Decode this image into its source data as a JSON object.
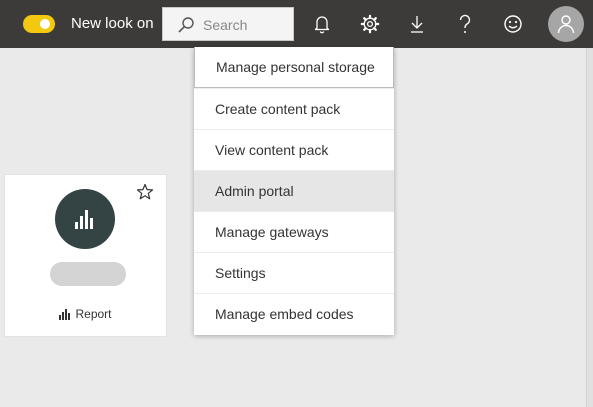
{
  "topbar": {
    "toggle": {
      "label": "New look on",
      "state": "on",
      "color": "#f2c811"
    },
    "search": {
      "placeholder": "Search",
      "value": ""
    },
    "icons": [
      "bell-icon",
      "gear-icon",
      "download-icon",
      "help-icon",
      "smiley-icon",
      "user-avatar-icon"
    ],
    "background": "#3c3b39"
  },
  "dropdown": {
    "items": [
      {
        "label": "Manage personal storage"
      },
      {
        "label": "Create content pack"
      },
      {
        "label": "View content pack"
      },
      {
        "label": "Admin portal",
        "hovered": true
      },
      {
        "label": "Manage gateways"
      },
      {
        "label": "Settings"
      },
      {
        "label": "Manage embed codes"
      }
    ]
  },
  "card": {
    "type_label": "Report",
    "favorite": false,
    "icon": "bar-chart-icon",
    "circle_color": "#344444"
  }
}
